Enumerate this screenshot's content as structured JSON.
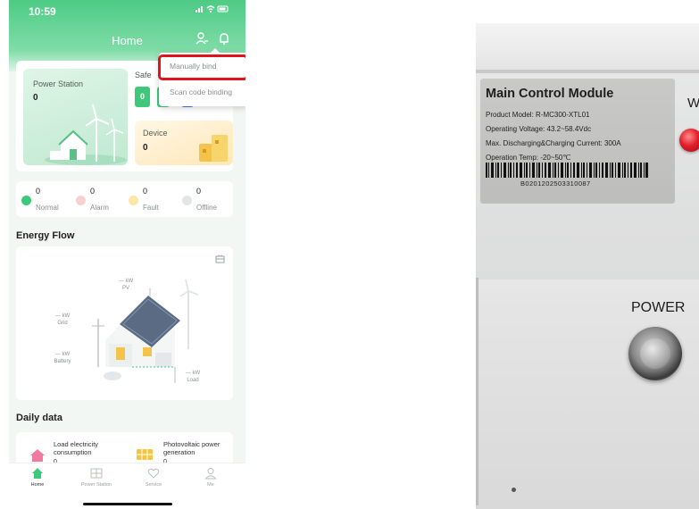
{
  "status_bar": {
    "time": "10:59",
    "indicators": "signal wifi battery"
  },
  "header": {
    "title": "Home"
  },
  "dropdown": {
    "items": [
      {
        "label": "Manually bind",
        "highlighted": true
      },
      {
        "label": "Scan code binding"
      }
    ]
  },
  "overview": {
    "power_station": {
      "label": "Power Station",
      "value": "0"
    },
    "safe": {
      "label": "Safe",
      "value": "0"
    },
    "device": {
      "label": "Device",
      "value": "0"
    }
  },
  "device_status": [
    {
      "label": "Normal",
      "count": "0",
      "color": "#3ec87a"
    },
    {
      "label": "Alarm",
      "count": "0",
      "color": "#f06a6a"
    },
    {
      "label": "Fault",
      "count": "0",
      "color": "#f5c542"
    },
    {
      "label": "Offline",
      "count": "0",
      "color": "#b9c0bb"
    }
  ],
  "energy_flow": {
    "title": "Energy Flow",
    "pv": {
      "value": "--- kW",
      "label": "PV"
    },
    "grid": {
      "value": "--- kW",
      "label": "Grid"
    },
    "battery": {
      "value": "--- kW",
      "label": "Battery"
    },
    "load": {
      "value": "--- kW",
      "label": "Load"
    }
  },
  "daily_data": {
    "title": "Daily data",
    "items": [
      {
        "label_line1": "Load electricity",
        "label_line2": "consumption",
        "value": "0"
      },
      {
        "label_line1": "Photovoltaic power",
        "label_line2": "generation",
        "value": "0"
      }
    ]
  },
  "tabbar": {
    "items": [
      {
        "label": "Home",
        "active": true
      },
      {
        "label": "Power Station"
      },
      {
        "label": "Service"
      },
      {
        "label": "Me"
      }
    ]
  },
  "photo": {
    "plate_title": "Main Control Module",
    "lines": [
      "Product Model: R-MC300-XTL01",
      "Operating Voltage: 43.2~58.4Vdc",
      "Max. Discharging&Charging Current: 300A",
      "Operation Temp: -20~50℃"
    ],
    "serial": "B0201202503310087",
    "wifi_label": "WIF",
    "power_label": "POWER"
  },
  "colors": {
    "accent": "#4ecb85",
    "highlight": "#e0141c"
  }
}
